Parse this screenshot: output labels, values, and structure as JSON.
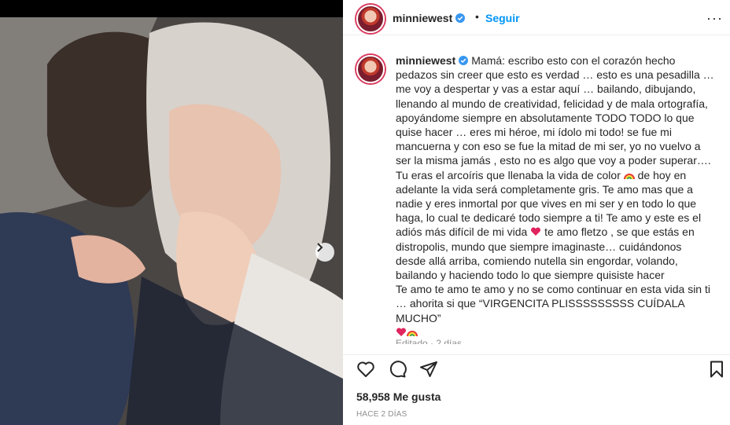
{
  "post": {
    "username": "minniewest",
    "header_separator": "•",
    "follow_label": "Seguir",
    "more_label": "···",
    "caption_p1": "Mamá: escribo esto con el corazón hecho pedazos sin creer que esto es verdad … esto es una pesadilla … me voy a despertar y vas a estar aquí … bailando, dibujando, llenando al mundo de creatividad, felicidad y de mala ortografía, apoyándome siempre en absolutamente TODO TODO lo que quise hacer … eres mi héroe, mi ídolo mi todo! se fue mi mancuerna y con eso se fue la mitad de mi ser, yo no vuelvo a ser la misma jamás , esto no es algo que voy a poder superar…. Tu eras el arcoíris que llenaba la vida de color",
    "caption_p2": " de hoy en adelante la vida será completamente gris. Te amo mas que a nadie y eres inmortal por que vives en mi ser y en todo lo que haga, lo cual te dedicaré todo siempre a ti! Te amo y este es el adiós más difícil de mi vida",
    "caption_p3": " te amo fletzo , se que estás en distropolis, mundo que siempre imaginaste… cuidándonos desde allá arriba, comiendo nutella sin engordar, volando, bailando y haciendo todo lo que siempre quisiste hacer\nTe amo te amo te amo y no se como continuar en esta vida sin ti … ahorita si que “VIRGENCITA PLISSSSSSSSS CUÍDALA MUCHO”\n",
    "edited_label": "Editado · 2 días",
    "likes": "58,958 Me gusta",
    "time_ago": "HACE 2 DÍAS"
  },
  "icons": {
    "like": "heart-outline-icon",
    "comment": "comment-icon",
    "share": "paper-plane-icon",
    "save": "bookmark-icon",
    "next": "chevron-right-icon",
    "verified": "verified-badge-icon"
  },
  "colors": {
    "accent": "#0095f6",
    "verified": "#3897f0",
    "heart": "#e0245e"
  }
}
